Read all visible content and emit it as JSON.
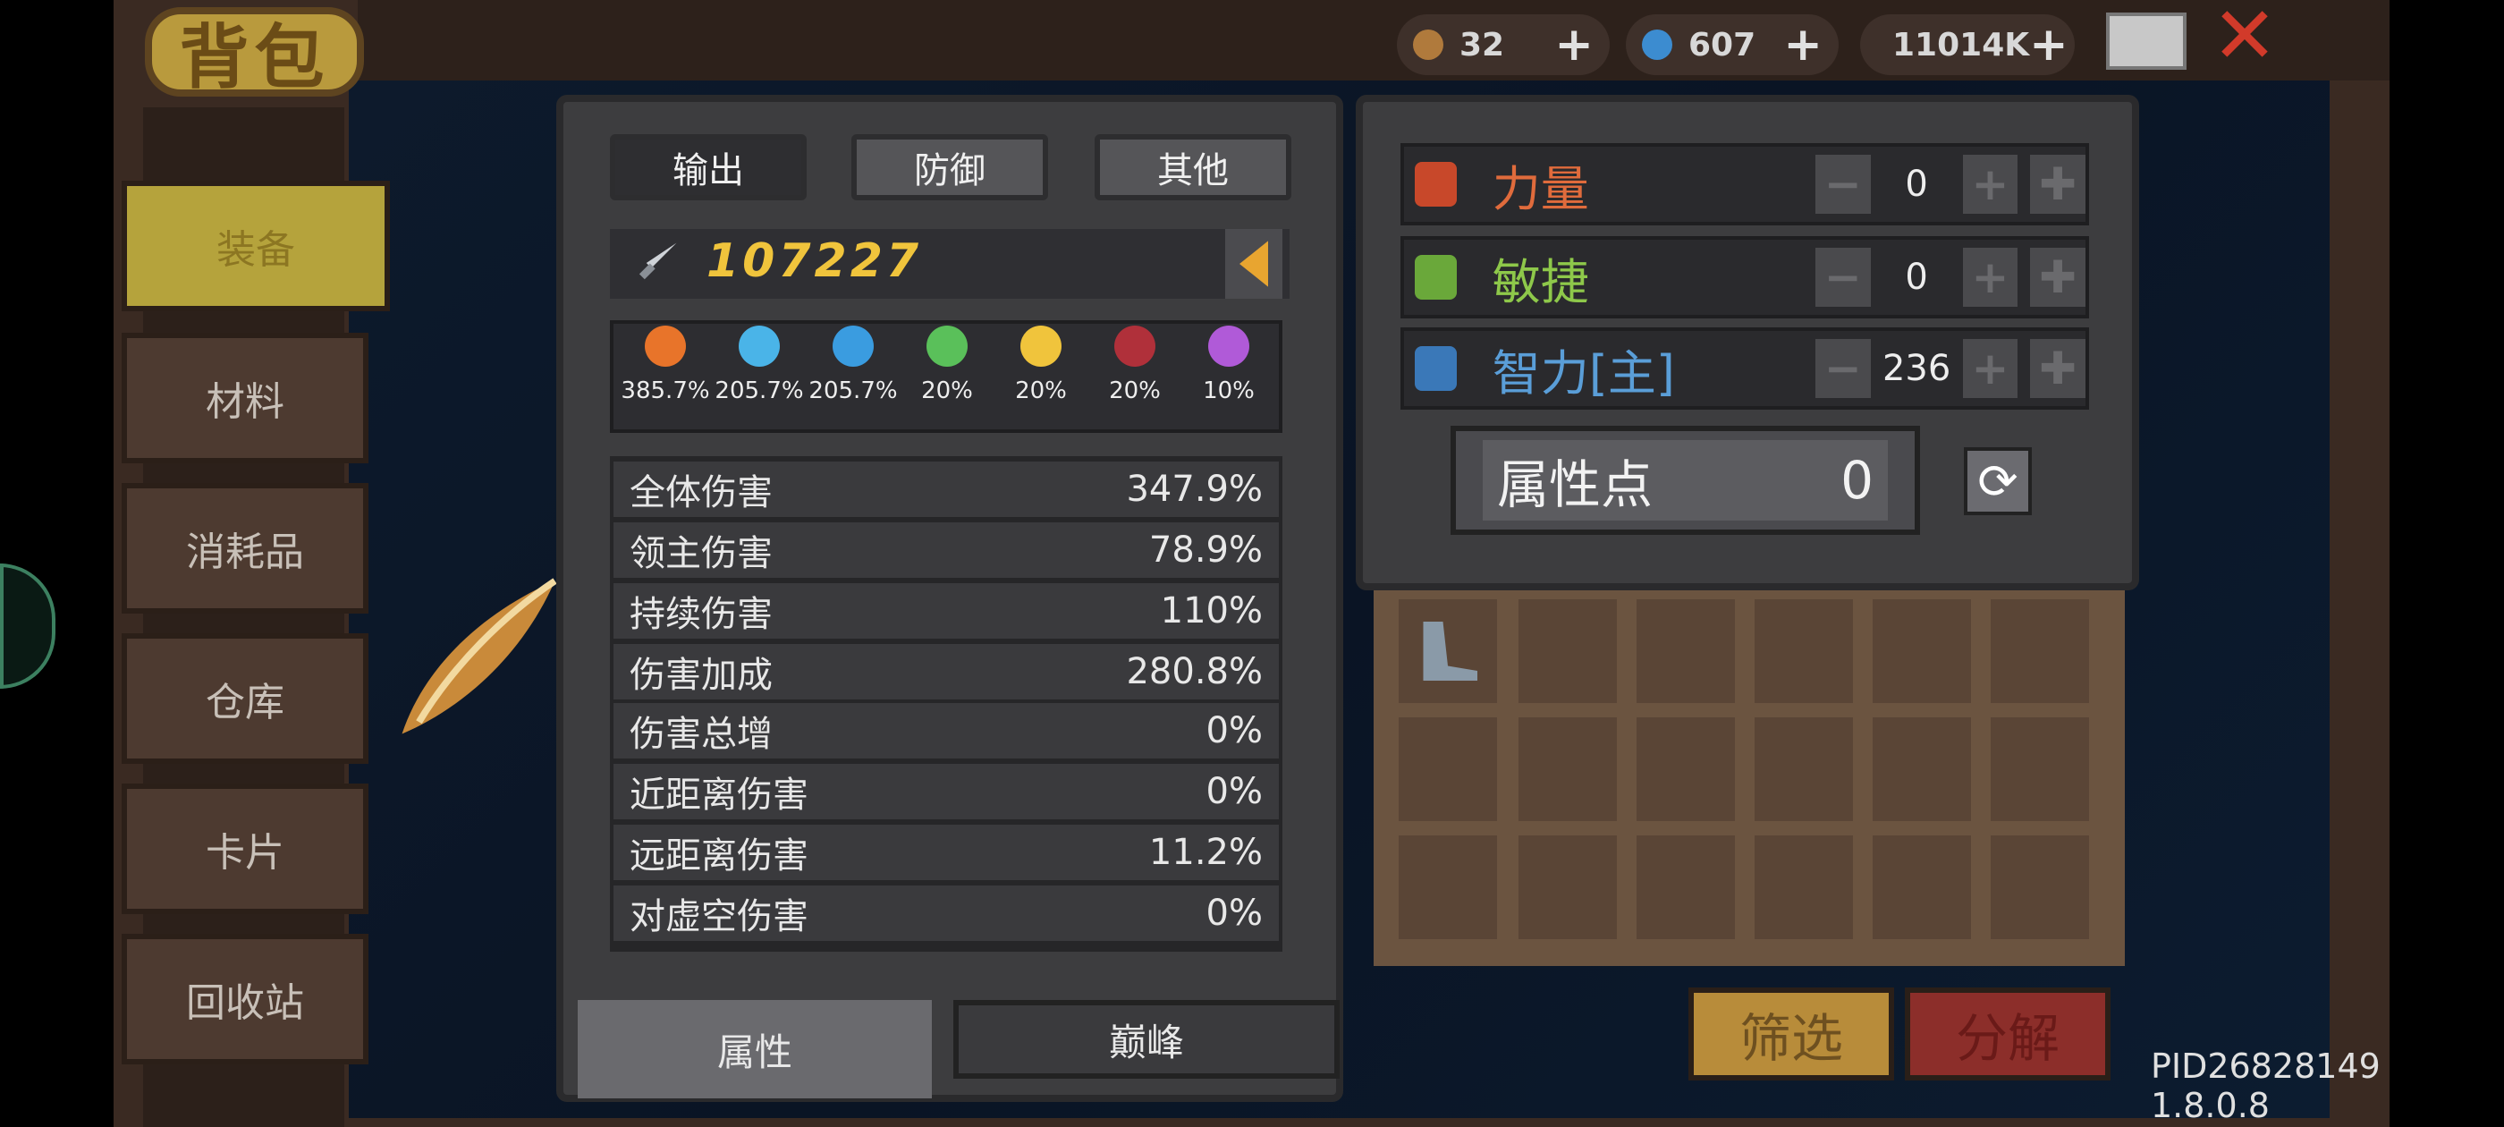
{
  "header": {
    "title": "背包"
  },
  "currencies": [
    {
      "icon": "arrow-quiver-icon",
      "value": "32"
    },
    {
      "icon": "gem-icon",
      "value": "607"
    },
    {
      "icon": "gold-coin-icon",
      "value": "11014K"
    }
  ],
  "sidebar": {
    "items": [
      {
        "label": "装备",
        "active": true
      },
      {
        "label": "材料"
      },
      {
        "label": "消耗品"
      },
      {
        "label": "仓库"
      },
      {
        "label": "卡片"
      },
      {
        "label": "回收站"
      }
    ]
  },
  "stats_panel": {
    "tabs": [
      "输出",
      "防御",
      "其他"
    ],
    "power": "107227",
    "elements": [
      {
        "icon": "fire-icon",
        "value": "385.7%"
      },
      {
        "icon": "ice-crystal-icon",
        "value": "205.7%"
      },
      {
        "icon": "lightning-icon",
        "value": "205.7%"
      },
      {
        "icon": "poison-skull-icon",
        "value": "20%"
      },
      {
        "icon": "sun-icon",
        "value": "20%"
      },
      {
        "icon": "crescent-moon-icon",
        "value": "20%"
      },
      {
        "icon": "void-star-icon",
        "value": "10%"
      }
    ],
    "rows": [
      {
        "label": "全体伤害",
        "value": "347.9%"
      },
      {
        "label": "领主伤害",
        "value": "78.9%"
      },
      {
        "label": "持续伤害",
        "value": "110%"
      },
      {
        "label": "伤害加成",
        "value": "280.8%"
      },
      {
        "label": "伤害总增",
        "value": "0%"
      },
      {
        "label": "近距离伤害",
        "value": "0%"
      },
      {
        "label": "远距离伤害",
        "value": "11.2%"
      },
      {
        "label": "对虚空伤害",
        "value": "0%"
      }
    ],
    "bottom_tabs": [
      "属性",
      "巅峰"
    ]
  },
  "attributes": {
    "rows": [
      {
        "name": "力量",
        "value": "0",
        "color": "#e06b3c",
        "icon": "fist-icon"
      },
      {
        "name": "敏捷",
        "value": "0",
        "color": "#8ec84a",
        "icon": "feather-icon"
      },
      {
        "name": "智力[主]",
        "value": "236",
        "color": "#5a9ed8",
        "icon": "book-icon"
      }
    ],
    "points_label": "属性点",
    "points_value": "0",
    "minus": "−",
    "plus": "+"
  },
  "actions": {
    "filter": "筛选",
    "decompose": "分解"
  },
  "footer": {
    "pid": "PID26828149 1.8.0.8"
  }
}
